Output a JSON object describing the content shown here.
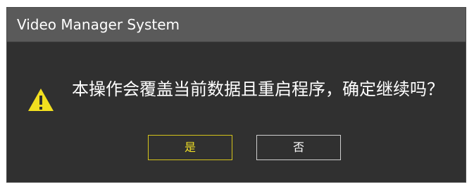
{
  "dialog": {
    "title": "Video Manager System",
    "icon": "warning-icon",
    "message": "本操作会覆盖当前数据且重启程序，确定继续吗？",
    "buttons": {
      "yes_label": "是",
      "no_label": "否"
    }
  },
  "colors": {
    "dialog_background": "#303030",
    "title_bar_background": "#5a5a5a",
    "accent": "#f0df25",
    "icon_fill": "#f2df1f",
    "text": "#ffffff"
  }
}
